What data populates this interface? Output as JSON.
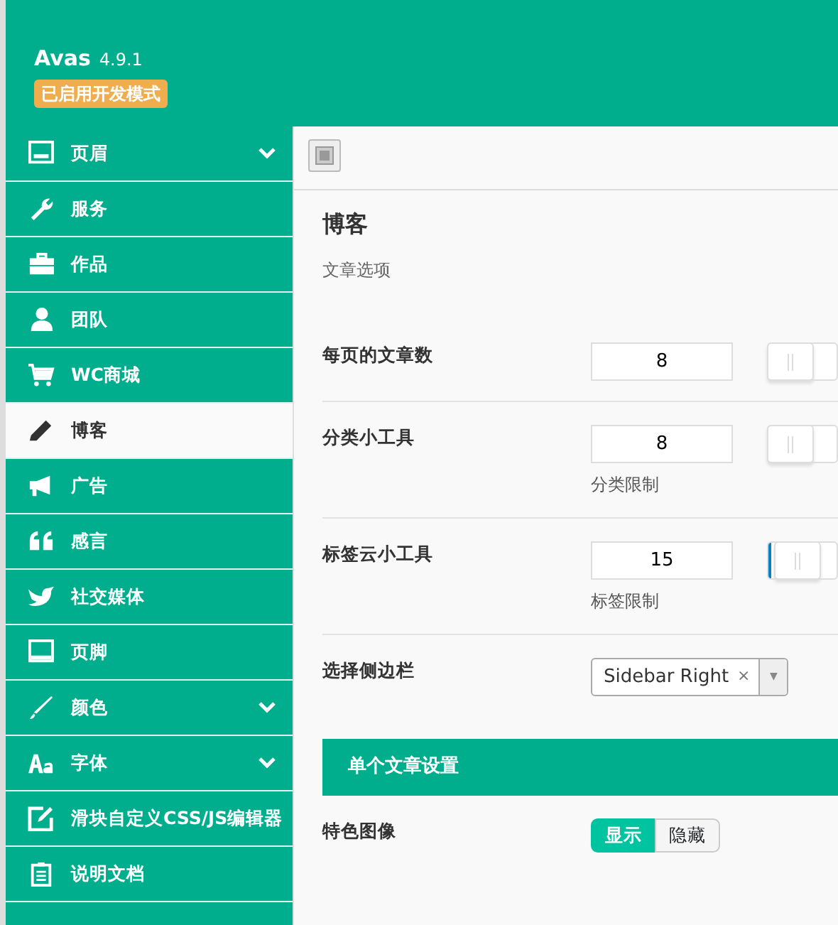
{
  "header": {
    "title": "Avas",
    "version": "4.9.1",
    "badge": "已启用开发模式"
  },
  "sidebar": {
    "items": [
      {
        "label": "页眉",
        "expandable": true,
        "selected": false
      },
      {
        "label": "服务",
        "expandable": false,
        "selected": false
      },
      {
        "label": "作品",
        "expandable": false,
        "selected": false
      },
      {
        "label": "团队",
        "expandable": false,
        "selected": false
      },
      {
        "label": "WC商城",
        "expandable": false,
        "selected": false
      },
      {
        "label": "博客",
        "expandable": false,
        "selected": true
      },
      {
        "label": "广告",
        "expandable": false,
        "selected": false
      },
      {
        "label": "感言",
        "expandable": false,
        "selected": false
      },
      {
        "label": "社交媒体",
        "expandable": false,
        "selected": false
      },
      {
        "label": "页脚",
        "expandable": false,
        "selected": false
      },
      {
        "label": "颜色",
        "expandable": true,
        "selected": false
      },
      {
        "label": "字体",
        "expandable": true,
        "selected": false
      },
      {
        "label": "滑块自定义CSS/JS编辑器",
        "expandable": false,
        "selected": false
      },
      {
        "label": "说明文档",
        "expandable": false,
        "selected": false
      }
    ]
  },
  "content": {
    "title": "博客",
    "subtitle": "文章选项",
    "settings": [
      {
        "kind": "slider",
        "label": "每页的文章数",
        "value": "8",
        "level": 0
      },
      {
        "kind": "slider",
        "label": "分类小工具",
        "value": "8",
        "hint": "分类限制",
        "level": 0
      },
      {
        "kind": "slider",
        "label": "标签云小工具",
        "value": "15",
        "hint": "标签限制",
        "level": 0.04
      },
      {
        "kind": "select",
        "label": "选择侧边栏",
        "value": "Sidebar Right",
        "clear": "×",
        "arrow": "▼"
      },
      {
        "kind": "section",
        "label": "单个文章设置"
      },
      {
        "kind": "toggle",
        "label": "特色图像",
        "options": [
          {
            "label": "显示",
            "selected": true
          },
          {
            "label": "隐藏",
            "selected": false
          }
        ]
      }
    ]
  }
}
